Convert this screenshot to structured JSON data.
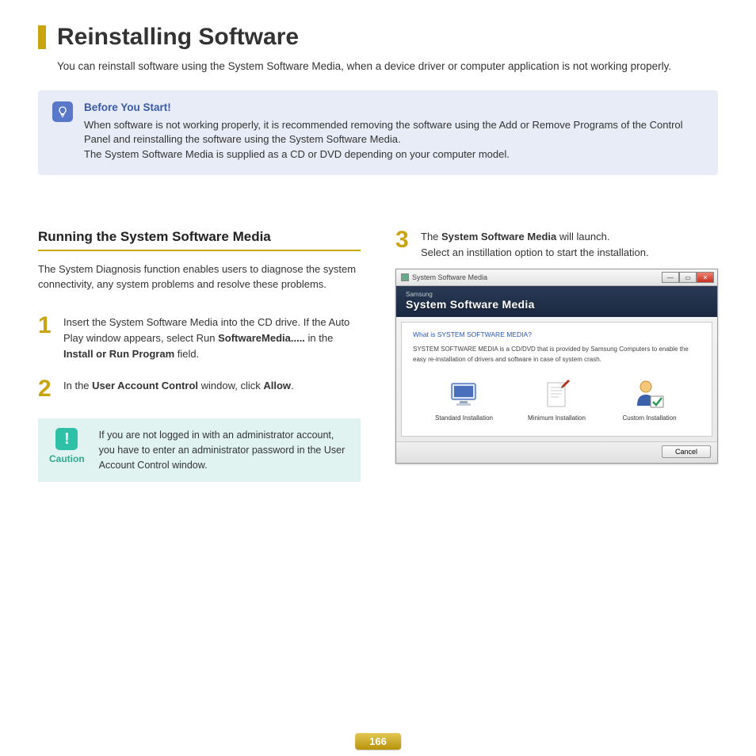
{
  "page": {
    "title": "Reinstalling Software",
    "intro": "You can reinstall software using the System Software Media, when a device driver or computer application is not working properly.",
    "number": "166"
  },
  "tip": {
    "title": "Before You Start!",
    "line1": "When software is not working properly, it is recommended removing the software using the Add or Remove Programs of the Control Panel and reinstalling the software using the System Software Media.",
    "line2": "The System Software Media is supplied as a CD or DVD depending on your computer model."
  },
  "section": {
    "heading": "Running the System Software Media",
    "desc": "The System Diagnosis function enables users to diagnose the system connectivity, any system problems and resolve these problems."
  },
  "steps": {
    "s1": {
      "num": "1",
      "pre": "Insert the System Software Media into the CD drive. If the Auto Play window appears, select Run ",
      "bold1": "SoftwareMedia.....",
      "mid": " in the ",
      "bold2": "Install or Run Program",
      "post": " field."
    },
    "s2": {
      "num": "2",
      "pre": "In the ",
      "bold1": "User Account Control",
      "mid": " window, click ",
      "bold2": "Allow",
      "post": "."
    },
    "s3": {
      "num": "3",
      "pre": "The ",
      "bold1": "System Software Media",
      "mid": " will launch.",
      "line2": "Select an instillation option to start the installation."
    }
  },
  "caution": {
    "label": "Caution",
    "text": "If you are not logged in with an administrator account, you have to enter an administrator password in the User Account Control window."
  },
  "screenshot": {
    "window_title": "System Software Media",
    "brand": "Samsung",
    "app_title": "System Software Media",
    "question": "What is SYSTEM SOFTWARE MEDIA?",
    "answer": "SYSTEM SOFTWARE MEDIA is a CD/DVD that is provided by Samsung Computers to enable the easy re-installation of drivers and software in case of system crash.",
    "opt1": "Standard Installation",
    "opt2": "Minimum Installation",
    "opt3": "Custom Installation",
    "cancel": "Cancel"
  }
}
